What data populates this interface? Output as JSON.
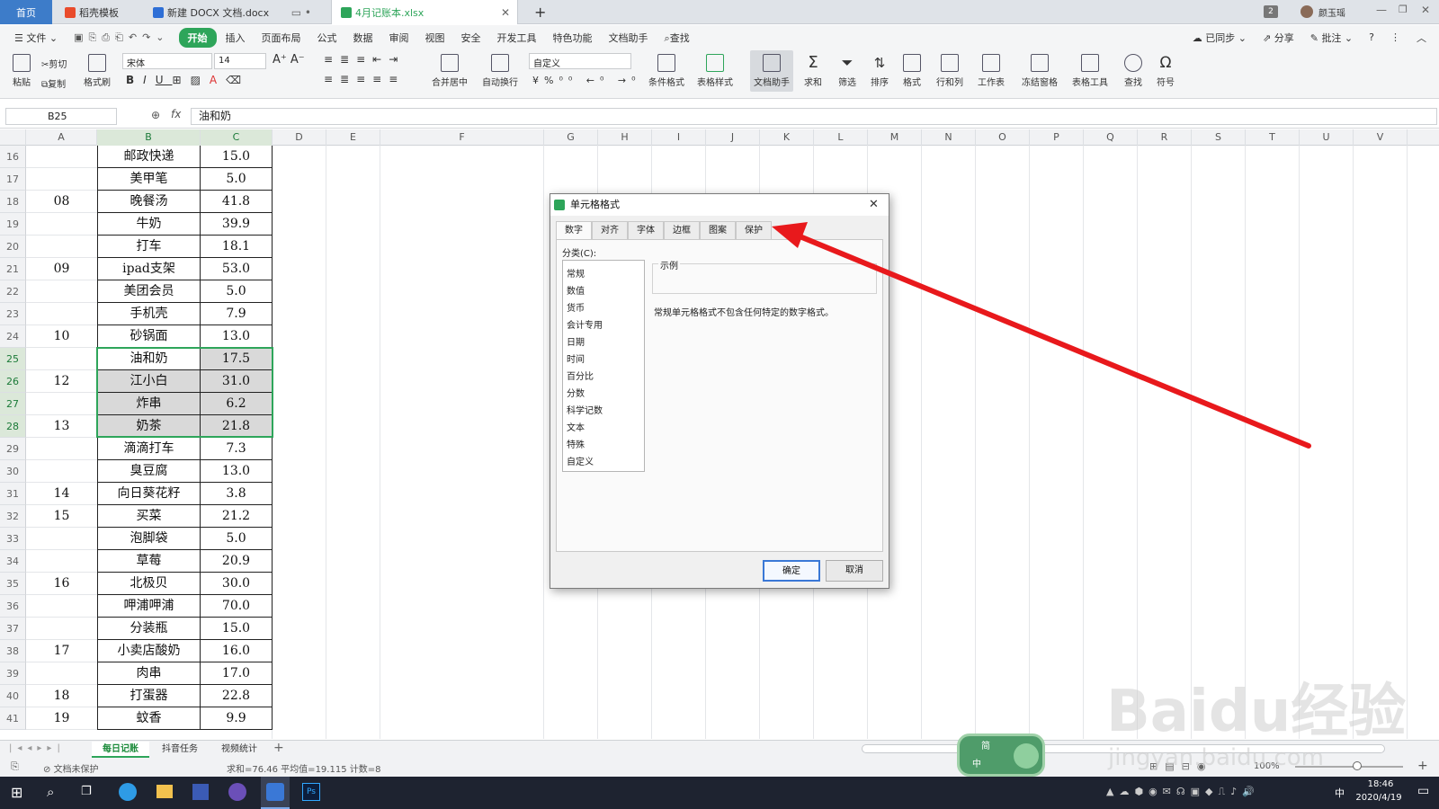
{
  "tabs": [
    {
      "label": "首页"
    },
    {
      "label": "稻壳模板"
    },
    {
      "label": "新建 DOCX 文档.docx"
    },
    {
      "label": "4月记账本.xlsx"
    }
  ],
  "user": {
    "name": "颜玉瑶",
    "badge": "2"
  },
  "menu": [
    "文件",
    "开始",
    "插入",
    "页面布局",
    "公式",
    "数据",
    "审阅",
    "视图",
    "安全",
    "开发工具",
    "特色功能",
    "文档助手",
    "查找"
  ],
  "menu_right": [
    "已同步",
    "分享",
    "批注"
  ],
  "ribbon": {
    "paste": "粘贴",
    "cut": "剪切",
    "copy": "复制",
    "format_painter": "格式刷",
    "font_name": "宋体",
    "font_size": "14",
    "merge": "合并居中",
    "wrap": "自动换行",
    "number_format": "自定义",
    "cond_format": "条件格式",
    "table_style": "表格样式",
    "doc_assistant": "文档助手",
    "sum": "求和",
    "filter": "筛选",
    "sort": "排序",
    "format": "格式",
    "rowcol": "行和列",
    "sheet": "工作表",
    "freeze": "冻结窗格",
    "table_tools": "表格工具",
    "find": "查找",
    "symbol": "符号"
  },
  "formula_bar": {
    "cell_ref": "B25",
    "fx": "fx",
    "value": "油和奶"
  },
  "columns": [
    "A",
    "B",
    "C",
    "D",
    "E",
    "F",
    "G",
    "H",
    "I",
    "J",
    "K",
    "L",
    "M",
    "N",
    "O",
    "P",
    "Q",
    "R",
    "S",
    "T",
    "U",
    "V"
  ],
  "rows": [
    {
      "n": "16",
      "a": "",
      "b": "邮政快递",
      "c": "15.0"
    },
    {
      "n": "17",
      "a": "",
      "b": "美甲笔",
      "c": "5.0"
    },
    {
      "n": "18",
      "a": "08",
      "b": "晚餐汤",
      "c": "41.8"
    },
    {
      "n": "19",
      "a": "",
      "b": "牛奶",
      "c": "39.9"
    },
    {
      "n": "20",
      "a": "",
      "b": "打车",
      "c": "18.1"
    },
    {
      "n": "21",
      "a": "09",
      "b": "ipad支架",
      "c": "53.0"
    },
    {
      "n": "22",
      "a": "",
      "b": "美团会员",
      "c": "5.0"
    },
    {
      "n": "23",
      "a": "",
      "b": "手机壳",
      "c": "7.9"
    },
    {
      "n": "24",
      "a": "10",
      "b": "砂锅面",
      "c": "13.0"
    },
    {
      "n": "25",
      "a": "",
      "b": "油和奶",
      "c": "17.5"
    },
    {
      "n": "26",
      "a": "12",
      "b": "江小白",
      "c": "31.0"
    },
    {
      "n": "27",
      "a": "",
      "b": "炸串",
      "c": "6.2"
    },
    {
      "n": "28",
      "a": "13",
      "b": "奶茶",
      "c": "21.8"
    },
    {
      "n": "29",
      "a": "",
      "b": "滴滴打车",
      "c": "7.3"
    },
    {
      "n": "30",
      "a": "",
      "b": "臭豆腐",
      "c": "13.0"
    },
    {
      "n": "31",
      "a": "14",
      "b": "向日葵花籽",
      "c": "3.8"
    },
    {
      "n": "32",
      "a": "15",
      "b": "买菜",
      "c": "21.2"
    },
    {
      "n": "33",
      "a": "",
      "b": "泡脚袋",
      "c": "5.0"
    },
    {
      "n": "34",
      "a": "",
      "b": "草莓",
      "c": "20.9"
    },
    {
      "n": "35",
      "a": "16",
      "b": "北极贝",
      "c": "30.0"
    },
    {
      "n": "36",
      "a": "",
      "b": "呷浦呷浦",
      "c": "70.0"
    },
    {
      "n": "37",
      "a": "",
      "b": "分装瓶",
      "c": "15.0"
    },
    {
      "n": "38",
      "a": "17",
      "b": "小卖店酸奶",
      "c": "16.0"
    },
    {
      "n": "39",
      "a": "",
      "b": "肉串",
      "c": "17.0"
    },
    {
      "n": "40",
      "a": "18",
      "b": "打蛋器",
      "c": "22.8"
    },
    {
      "n": "41",
      "a": "19",
      "b": "蚊香",
      "c": "9.9"
    }
  ],
  "sheet_tabs": [
    "每日记账",
    "抖音任务",
    "视频统计"
  ],
  "status": {
    "protect": "文档未保护",
    "summary": "求和=76.46  平均值=19.115  计数=8",
    "zoom": "100%"
  },
  "dialog": {
    "title": "单元格格式",
    "tabs": [
      "数字",
      "对齐",
      "字体",
      "边框",
      "图案",
      "保护"
    ],
    "category_label": "分类(C):",
    "categories": [
      "常规",
      "数值",
      "货币",
      "会计专用",
      "日期",
      "时间",
      "百分比",
      "分数",
      "科学记数",
      "文本",
      "特殊",
      "自定义"
    ],
    "sample_label": "示例",
    "description": "常规单元格格式不包含任何特定的数字格式。",
    "ok": "确定",
    "cancel": "取消"
  },
  "ime": {
    "mode": "简",
    "lang": "中"
  },
  "watermark": "Baidu经验",
  "watermark_url": "jingyan.baidu.com",
  "taskbar": {
    "time": "18:46",
    "date": "2020/4/19",
    "ime": "中"
  },
  "colors": {
    "accent_green": "#2ea55a",
    "arrow_red": "#e8191c",
    "selection_fill": "#d9d9d9"
  }
}
